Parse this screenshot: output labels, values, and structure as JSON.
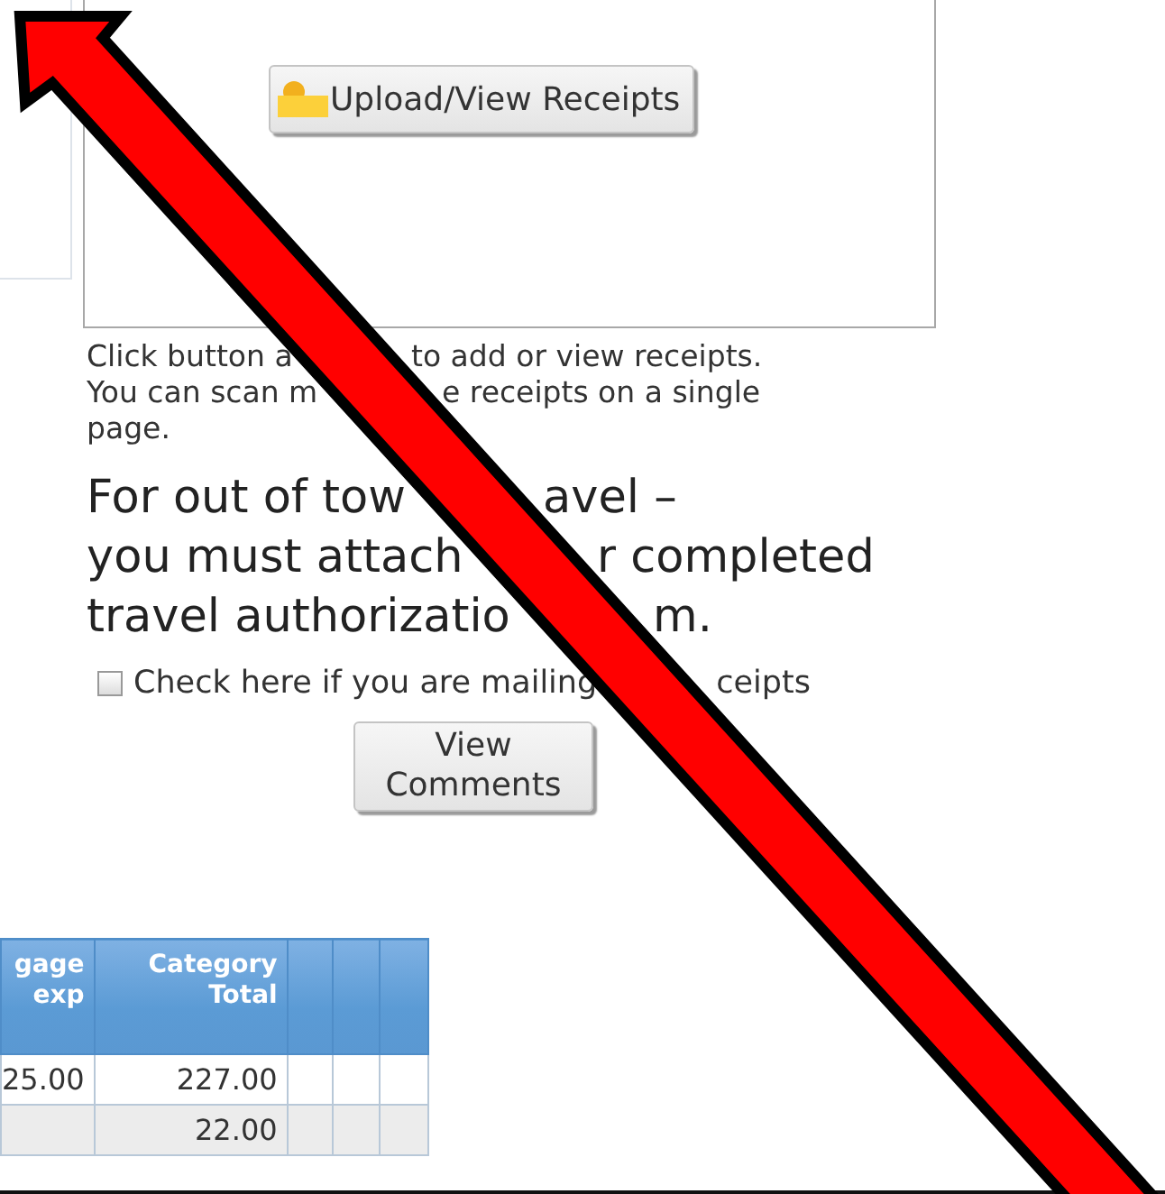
{
  "receipts": {
    "upload_button": "Upload/View Receipts",
    "help_lines": [
      [
        "Click button a",
        "to add or view receipts."
      ],
      [
        "You can scan m",
        "e receipts on a single"
      ],
      [
        "page."
      ]
    ],
    "notice_lines": [
      [
        "For out of tow",
        "avel –"
      ],
      [
        "you must attach",
        "r completed"
      ],
      [
        "travel authorizatio",
        "m."
      ]
    ],
    "mailing_checkbox": {
      "parts": [
        "Check here if you are mailing",
        "ceipts"
      ],
      "checked": false
    },
    "comments_button": "View Comments"
  },
  "table": {
    "columns": [
      "gage exp",
      "Category Total",
      "",
      "",
      ""
    ],
    "rows": [
      [
        "25.00",
        "227.00"
      ],
      [
        "",
        "22.00"
      ]
    ]
  },
  "annotation": {
    "kind": "arrow"
  }
}
